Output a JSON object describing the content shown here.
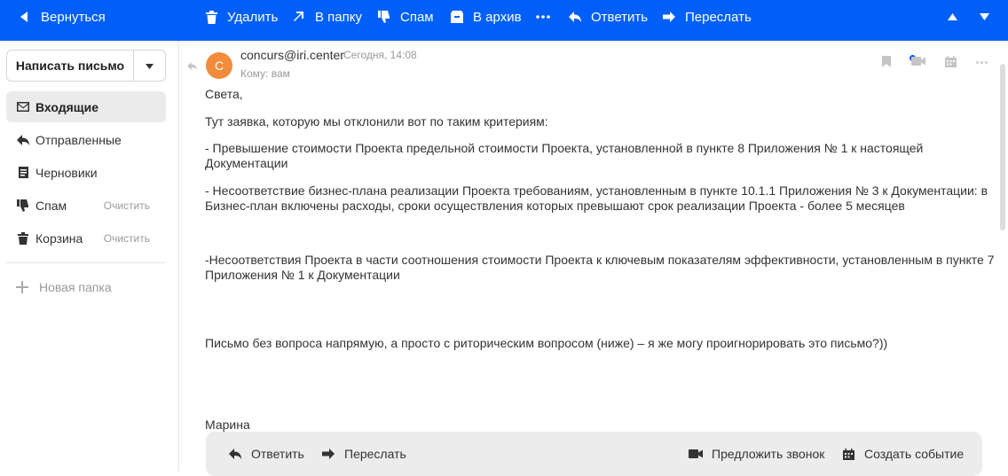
{
  "toolbar": {
    "back": "Вернуться",
    "delete": "Удалить",
    "to_folder": "В папку",
    "spam": "Спам",
    "archive": "В архив",
    "reply": "Ответить",
    "forward": "Переслать"
  },
  "sidebar": {
    "compose": "Написать письмо",
    "folders": [
      {
        "label": "Входящие",
        "icon": "inbox-icon"
      },
      {
        "label": "Отправленные",
        "icon": "sent-icon"
      },
      {
        "label": "Черновики",
        "icon": "drafts-icon"
      },
      {
        "label": "Спам",
        "icon": "spam-icon",
        "action": "Очистить"
      },
      {
        "label": "Корзина",
        "icon": "trash-icon",
        "action": "Очистить"
      }
    ],
    "new_folder": "Новая папка"
  },
  "message": {
    "avatar_letter": "C",
    "sender": "concurs@iri.center",
    "date": "Сегодня, 14:08",
    "to": "Кому: вам",
    "lines": [
      "Света,",
      "Тут заявка, которую мы отклонили вот по таким критериям:",
      "- Превышение стоимости Проекта предельной стоимости Проекта, установленной в пункте 8 Приложения № 1 к настоящей Документации",
      "- Несоответствие бизнес-плана реализации Проекта требованиям, установленным в пункте 10.1.1 Приложения № 3 к Документации: в",
      "Бизнес-план включены расходы, сроки осуществления которых превышают срок реализации Проекта - более 5 месяцев",
      "-Несоответствия Проекта в части соотношения стоимости Проекта к ключевым показателям эффективности, установленным в пункте 7",
      "Приложения № 1 к Документации",
      "Письмо без вопроса напрямую, а просто с риторическим вопросом (ниже) – я же могу проигнорировать это письмо?))",
      "Марина"
    ]
  },
  "reply_bar": {
    "reply": "Ответить",
    "forward": "Переслать",
    "suggest_call": "Предложить звонок",
    "create_event": "Создать событие"
  },
  "colors": {
    "accent": "#005ff9",
    "avatar": "#f28c3c"
  }
}
